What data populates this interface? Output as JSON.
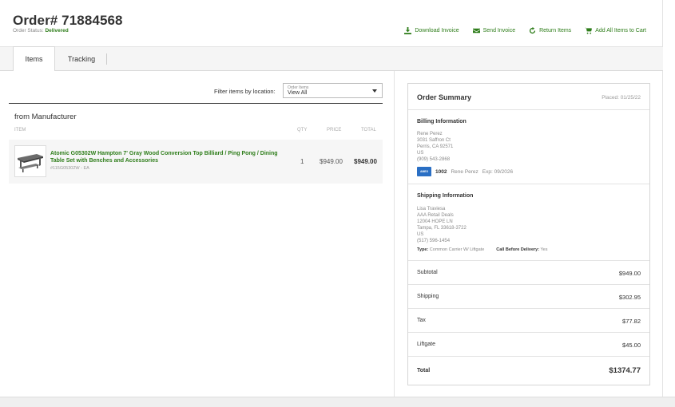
{
  "header": {
    "order_title": "Order# 71884568",
    "status_label": "Order Status:",
    "status_value": "Delivered"
  },
  "actions": {
    "download": "Download Invoice",
    "send": "Send Invoice",
    "return": "Return Items",
    "add_all": "Add All Items to Cart"
  },
  "tabs": {
    "items": "Items",
    "tracking": "Tracking"
  },
  "filter": {
    "label": "Filter items by location:",
    "select_caption": "Order Items",
    "select_value": "View All"
  },
  "section": {
    "title": "from Manufacturer",
    "columns": {
      "item": "ITEM",
      "qty": "QTY",
      "price": "PRICE",
      "total": "TOTAL"
    }
  },
  "item": {
    "name": "Atomic G05302W Hampton 7' Gray Wood Conversion Top Billiard / Ping Pong / Dining Table Set with Benches and Accessories",
    "sku": "#115G05302W - EA",
    "qty": "1",
    "price": "$949.00",
    "total": "$949.00"
  },
  "summary": {
    "title": "Order Summary",
    "placed": "Placed: 01/25/22",
    "billing": {
      "title": "Billing Information",
      "name": "Rene Perez",
      "street": "3031 Saffron Ct",
      "city": "Perris, CA 92571",
      "country": "US",
      "phone": "(909) 543-2868",
      "card_brand": "AMEX",
      "card_last4": "1002",
      "card_holder": "Rene Perez",
      "card_exp": "Exp: 09/2026"
    },
    "shipping": {
      "title": "Shipping Information",
      "name": "Lisa Traviesa",
      "company": "AAA Retail Deals",
      "street": "12004 HOPE LN",
      "city": "Tampa, FL 33618-3722",
      "country": "US",
      "phone": "(517) 596-1454",
      "type_label": "Type:",
      "type_value": "Common Carrier W/ Liftgate",
      "call_label": "Call Before Delivery:",
      "call_value": "Yes"
    },
    "totals": {
      "subtotal_label": "Subtotal",
      "subtotal": "$949.00",
      "shipping_label": "Shipping",
      "shipping": "$302.95",
      "tax_label": "Tax",
      "tax": "$77.82",
      "liftgate_label": "Liftgate",
      "liftgate": "$45.00",
      "total_label": "Total",
      "total": "$1374.77"
    }
  },
  "colors": {
    "accent": "#2e7d1a",
    "card": "#2a6fc4"
  }
}
